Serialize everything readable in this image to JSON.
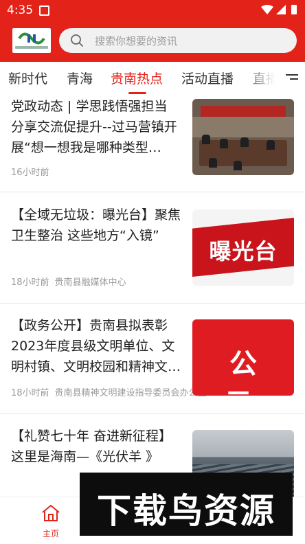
{
  "status_bar": {
    "time": "4:35"
  },
  "search": {
    "placeholder": "搜索你想要的资讯"
  },
  "tabs": [
    {
      "label": "新时代"
    },
    {
      "label": "青海"
    },
    {
      "label": "贵南热点",
      "active": true
    },
    {
      "label": "活动直播"
    },
    {
      "label": "直播"
    }
  ],
  "news": [
    {
      "title": "党政动态 | 学思践悟强担当 分享交流促提升--过马营镇开展“想一想我是哪种类型…",
      "time": "16小时前",
      "source": ""
    },
    {
      "title": "【全域无垃圾：曝光台】聚焦卫生整治  这些地方“入镜”",
      "time": "18小时前",
      "source": "贵南县融媒体中心",
      "thumb_text": "曝光台"
    },
    {
      "title": "【政务公开】贵南县拟表彰2023年度县级文明单位、文明村镇、文明校园和精神文…",
      "time": "18小时前",
      "source": "贵南县精神文明建设指导委员会办公室",
      "thumb_text": "公 示"
    },
    {
      "title": "【礼赞七十年  奋进新征程】这里是海南—《光伏羊  》",
      "time": "",
      "source": ""
    }
  ],
  "bottom_nav": {
    "home_label": "主页"
  },
  "watermark": {
    "text": "下载鸟资源"
  },
  "colors": {
    "brand": "#e3231a",
    "meta": "#9a9a9a"
  }
}
